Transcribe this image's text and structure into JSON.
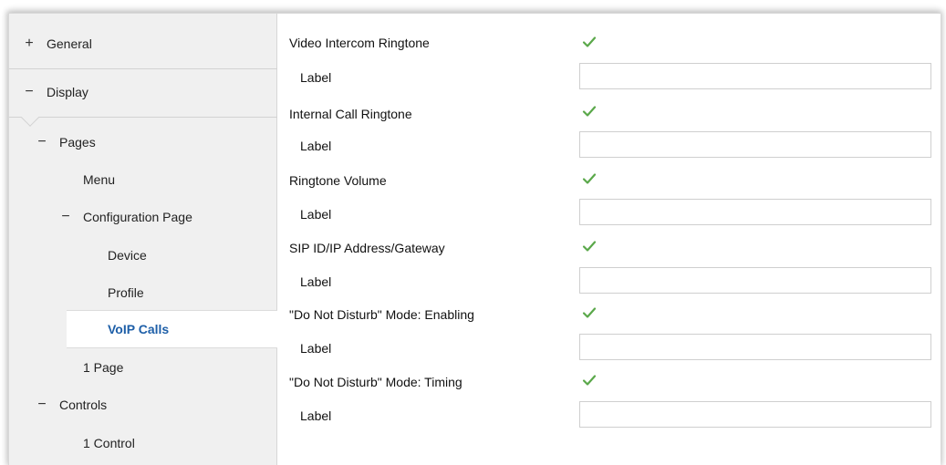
{
  "sidebar": {
    "items": [
      {
        "sign": "+",
        "label": "General"
      },
      {
        "sign": "−",
        "label": "Display"
      },
      {
        "sign": "−",
        "label": "Pages"
      },
      {
        "sign": "",
        "label": "Menu"
      },
      {
        "sign": "−",
        "label": "Configuration Page"
      },
      {
        "sign": "",
        "label": "Device"
      },
      {
        "sign": "",
        "label": "Profile"
      },
      {
        "sign": "",
        "label": "VoIP Calls"
      },
      {
        "sign": "",
        "label": "1 Page"
      },
      {
        "sign": "−",
        "label": "Controls"
      },
      {
        "sign": "",
        "label": "1 Control"
      }
    ]
  },
  "content": {
    "rows": [
      {
        "title": "Video Intercom Ringtone",
        "checked": true,
        "label": "Label",
        "value": ""
      },
      {
        "title": "Internal Call Ringtone",
        "checked": true,
        "label": "Label",
        "value": ""
      },
      {
        "title": "Ringtone Volume",
        "checked": true,
        "label": "Label",
        "value": ""
      },
      {
        "title": "SIP ID/IP Address/Gateway",
        "checked": true,
        "label": "Label",
        "value": ""
      },
      {
        "title": "\"Do Not Disturb\" Mode: Enabling",
        "checked": true,
        "label": "Label",
        "value": ""
      },
      {
        "title": "\"Do Not Disturb\" Mode: Timing",
        "checked": true,
        "label": "Label",
        "value": ""
      }
    ]
  },
  "colors": {
    "checkmark": "#5aa84a",
    "selected_text": "#1e5fa8",
    "sidebar_bg": "#f0f0f0"
  }
}
